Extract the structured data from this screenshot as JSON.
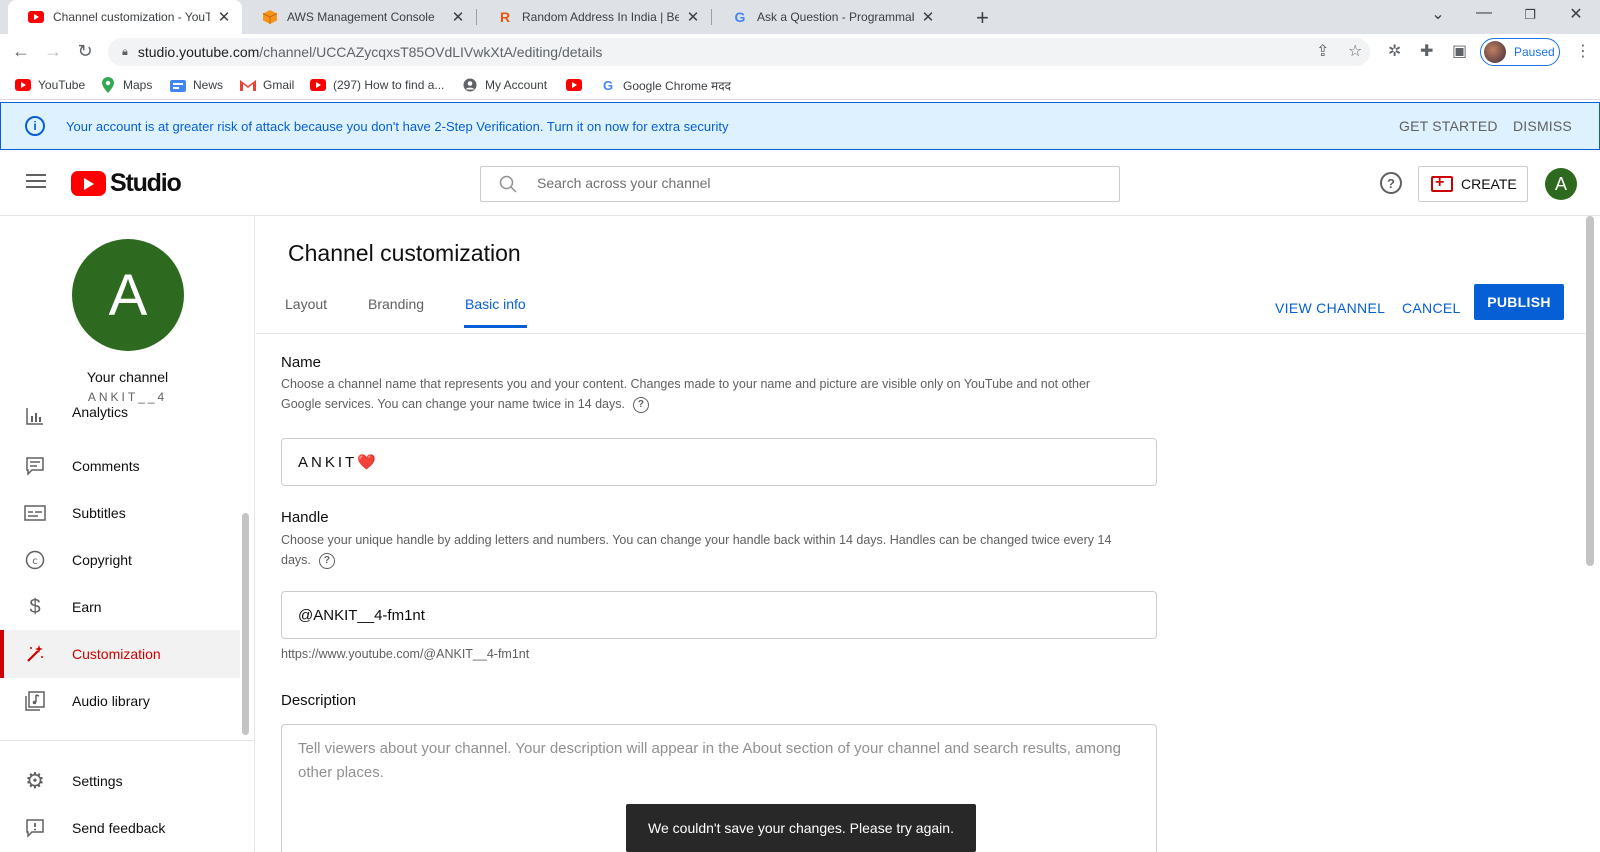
{
  "browser": {
    "tabs": [
      {
        "title": "Channel customization - YouTube Studio",
        "active": true
      },
      {
        "title": "AWS Management Console",
        "active": false
      },
      {
        "title": "Random Address In India | Best Random",
        "active": false
      },
      {
        "title": "Ask a Question - Programmable Search",
        "active": false
      }
    ],
    "url_host": "studio.youtube.com",
    "url_path": "/channel/UCCAZycqxsT85OVdLIVwkXtA/editing/details",
    "profile_status": "Paused",
    "bookmarks": [
      {
        "label": "YouTube",
        "icon": "youtube-icon"
      },
      {
        "label": "Maps",
        "icon": "maps-icon"
      },
      {
        "label": "News",
        "icon": "news-icon"
      },
      {
        "label": "Gmail",
        "icon": "gmail-icon"
      },
      {
        "label": "(297) How to find a...",
        "icon": "youtube-icon"
      },
      {
        "label": "My Account",
        "icon": "account-icon"
      },
      {
        "label": "",
        "icon": "youtube-icon"
      },
      {
        "label": "Google Chrome मदद",
        "icon": "google-icon"
      }
    ]
  },
  "banner": {
    "message": "Your account is at greater risk of attack because you don't have 2-Step Verification. Turn it on now for extra security",
    "get_started": "GET STARTED",
    "dismiss": "DISMISS"
  },
  "header": {
    "logo_text": "Studio",
    "search_placeholder": "Search across your channel",
    "create_label": "CREATE",
    "avatar_letter": "A"
  },
  "sidebar": {
    "avatar_letter": "A",
    "your_channel": "Your channel",
    "channel_handle": "ANKIT__4",
    "items": [
      {
        "label": "Analytics",
        "icon": "analytics-icon",
        "active": false
      },
      {
        "label": "Comments",
        "icon": "comments-icon",
        "active": false
      },
      {
        "label": "Subtitles",
        "icon": "subtitles-icon",
        "active": false
      },
      {
        "label": "Copyright",
        "icon": "copyright-icon",
        "active": false
      },
      {
        "label": "Earn",
        "icon": "dollar-icon",
        "active": false
      },
      {
        "label": "Customization",
        "icon": "magic-wand-icon",
        "active": true
      },
      {
        "label": "Audio library",
        "icon": "audio-library-icon",
        "active": false
      }
    ],
    "bottom_items": [
      {
        "label": "Settings",
        "icon": "gear-icon"
      },
      {
        "label": "Send feedback",
        "icon": "feedback-icon"
      }
    ]
  },
  "main": {
    "title": "Channel customization",
    "tabs": [
      {
        "label": "Layout",
        "active": false
      },
      {
        "label": "Branding",
        "active": false
      },
      {
        "label": "Basic info",
        "active": true
      }
    ],
    "view_channel": "VIEW CHANNEL",
    "cancel": "CANCEL",
    "publish": "PUBLISH",
    "name": {
      "title": "Name",
      "description": "Choose a channel name that represents you and your content. Changes made to your name and picture are visible only on YouTube and not other Google services. You can change your name twice in 14 days.",
      "value": "ANKIT❤️"
    },
    "handle": {
      "title": "Handle",
      "description": "Choose your unique handle by adding letters and numbers. You can change your handle back within 14 days. Handles can be changed twice every 14 days.",
      "value": "@ANKIT__4-fm1nt",
      "url": "https://www.youtube.com/@ANKIT__4-fm1nt"
    },
    "description": {
      "title": "Description",
      "placeholder": "Tell viewers about your channel. Your description will appear in the About section of your channel and search results, among other places."
    }
  },
  "toast": "We couldn't save your changes. Please try again.",
  "colors": {
    "youtube_red": "#ff0000",
    "active_red": "#cc0000",
    "link_blue": "#065fd4",
    "banner_bg": "#def1ff",
    "avatar_green": "#2d6a1f"
  }
}
